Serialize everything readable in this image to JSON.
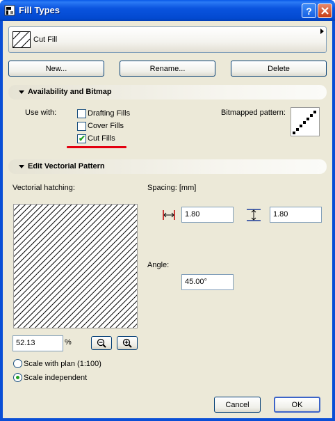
{
  "window": {
    "title": "Fill Types"
  },
  "preset": {
    "name": "Cut Fill"
  },
  "buttons": {
    "new": "New...",
    "rename": "Rename...",
    "delete": "Delete",
    "cancel": "Cancel",
    "ok": "OK"
  },
  "availability": {
    "section_title": "Availability and Bitmap",
    "use_with_label": "Use with:",
    "options": [
      {
        "label": "Drafting Fills",
        "checked": false
      },
      {
        "label": "Cover Fills",
        "checked": false
      },
      {
        "label": "Cut Fills",
        "checked": true
      }
    ],
    "bitmapped_pattern_label": "Bitmapped pattern:"
  },
  "vectorial": {
    "section_title": "Edit Vectorial Pattern",
    "hatching_label": "Vectorial hatching:",
    "spacing_label": "Spacing: [mm]",
    "spacing_horizontal": "1.80",
    "spacing_vertical": "1.80",
    "angle_label": "Angle:",
    "angle_value": "45.00°",
    "zoom_value": "52.13",
    "zoom_unit": "%",
    "scale_options": [
      {
        "label": "Scale with plan (1:100)",
        "selected": false
      },
      {
        "label": "Scale independent",
        "selected": true
      }
    ]
  },
  "colors": {
    "title_bar": "#0a54df",
    "dialog_bg": "#ece9d8",
    "highlight_underline": "#e3000f",
    "check_mark": "#21a121"
  }
}
